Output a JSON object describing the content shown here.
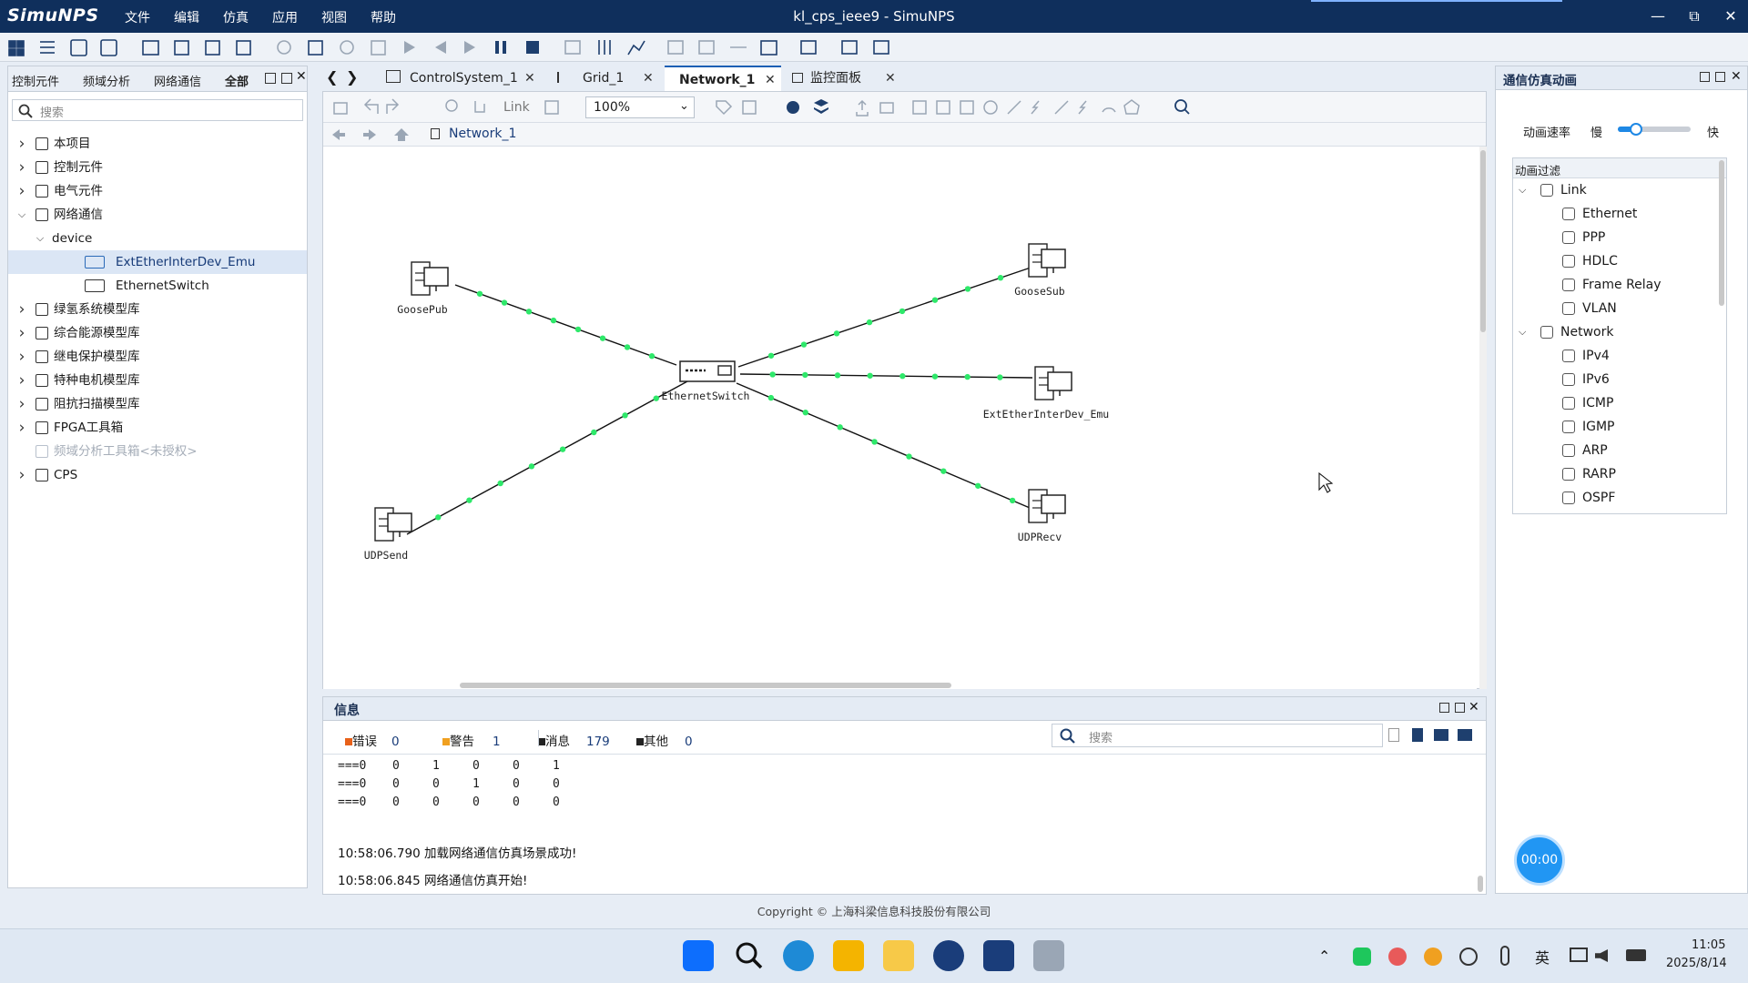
{
  "app": {
    "logo": "SimuNPS",
    "window_title": "kl_cps_ieee9 - SimuNPS",
    "menu": [
      "文件",
      "编辑",
      "仿真",
      "应用",
      "视图",
      "帮助"
    ]
  },
  "left_panel": {
    "tabs": [
      "控制元件",
      "频域分析",
      "网络通信",
      "全部"
    ],
    "active_tab": "全部",
    "search_placeholder": "搜索",
    "tree": [
      {
        "label": "本项目",
        "level": 0,
        "expanded": false
      },
      {
        "label": "控制元件",
        "level": 0,
        "expanded": false
      },
      {
        "label": "电气元件",
        "level": 0,
        "expanded": false
      },
      {
        "label": "网络通信",
        "level": 0,
        "expanded": true
      },
      {
        "label": "device",
        "level": 1,
        "expanded": true
      },
      {
        "label": "ExtEtherInterDev_Emu",
        "level": 2,
        "selected": true
      },
      {
        "label": "EthernetSwitch",
        "level": 2
      },
      {
        "label": "绿氢系统模型库",
        "level": 0,
        "expanded": false
      },
      {
        "label": "综合能源模型库",
        "level": 0,
        "expanded": false
      },
      {
        "label": "继电保护模型库",
        "level": 0,
        "expanded": false
      },
      {
        "label": "特种电机模型库",
        "level": 0,
        "expanded": false
      },
      {
        "label": "阻抗扫描模型库",
        "level": 0,
        "expanded": false
      },
      {
        "label": "FPGA工具箱",
        "level": 0,
        "expanded": false
      },
      {
        "label": "频域分析工具箱<未授权>",
        "level": 0,
        "disabled": true
      },
      {
        "label": "CPS",
        "level": 0,
        "expanded": false
      }
    ]
  },
  "doc_tabs": [
    {
      "label": "ControlSystem_1"
    },
    {
      "label": "Grid_1"
    },
    {
      "label": "Network_1",
      "active": true
    },
    {
      "label": "监控面板"
    }
  ],
  "editor": {
    "link_label": "Link",
    "zoom": "100%",
    "breadcrumb": "Network_1"
  },
  "network": {
    "nodes": [
      {
        "id": "GoosePub",
        "label": "GoosePub"
      },
      {
        "id": "GooseSub",
        "label": "GooseSub"
      },
      {
        "id": "EthernetSwitch",
        "label": "EthernetSwitch"
      },
      {
        "id": "ExtEtherInterDev_Emu",
        "label": "ExtEtherInterDev_Emu"
      },
      {
        "id": "UDPSend",
        "label": "UDPSend"
      },
      {
        "id": "UDPRecv",
        "label": "UDPRecv"
      }
    ],
    "links": [
      [
        "GoosePub",
        "EthernetSwitch"
      ],
      [
        "EthernetSwitch",
        "GooseSub"
      ],
      [
        "EthernetSwitch",
        "ExtEtherInterDev_Emu"
      ],
      [
        "UDPSend",
        "EthernetSwitch"
      ],
      [
        "EthernetSwitch",
        "UDPRecv"
      ]
    ],
    "link_color": "#111111",
    "packet_color": "#2ee86a"
  },
  "info_panel": {
    "title": "信息",
    "filters": [
      {
        "label": "错误",
        "count": "0",
        "color": "#e8611a"
      },
      {
        "label": "警告",
        "count": "1",
        "color": "#f0a020"
      },
      {
        "label": "消息",
        "count": "179",
        "color": "#222222"
      },
      {
        "label": "其他",
        "count": "0",
        "color": "#222222"
      }
    ],
    "search_placeholder": "搜索",
    "matrix_rows": [
      [
        "===0",
        "0",
        "1",
        "0",
        "0",
        "1"
      ],
      [
        "===0",
        "0",
        "0",
        "1",
        "0",
        "0"
      ],
      [
        "===0",
        "0",
        "0",
        "0",
        "0",
        "0"
      ]
    ],
    "log": [
      "10:58:06.790 加载网络通信仿真场景成功!",
      "10:58:06.845 网络通信仿真开始!"
    ]
  },
  "right_panel": {
    "title": "通信仿真动画",
    "speed_label": "动画速率",
    "slow": "慢",
    "fast": "快",
    "speed_level": 0.25,
    "filter_title": "动画过滤",
    "groups": [
      {
        "label": "Link",
        "items": [
          "Ethernet",
          "PPP",
          "HDLC",
          "Frame Relay",
          "VLAN"
        ]
      },
      {
        "label": "Network",
        "items": [
          "IPv4",
          "IPv6",
          "ICMP",
          "IGMP",
          "ARP",
          "RARP",
          "OSPF"
        ]
      }
    ],
    "timer": "00:00"
  },
  "status": {
    "copyright": "Copyright © 上海科梁信息科技股份有限公司"
  },
  "taskbar": {
    "tray_lang": "英",
    "time": "11:05",
    "date": "2025/8/14"
  }
}
